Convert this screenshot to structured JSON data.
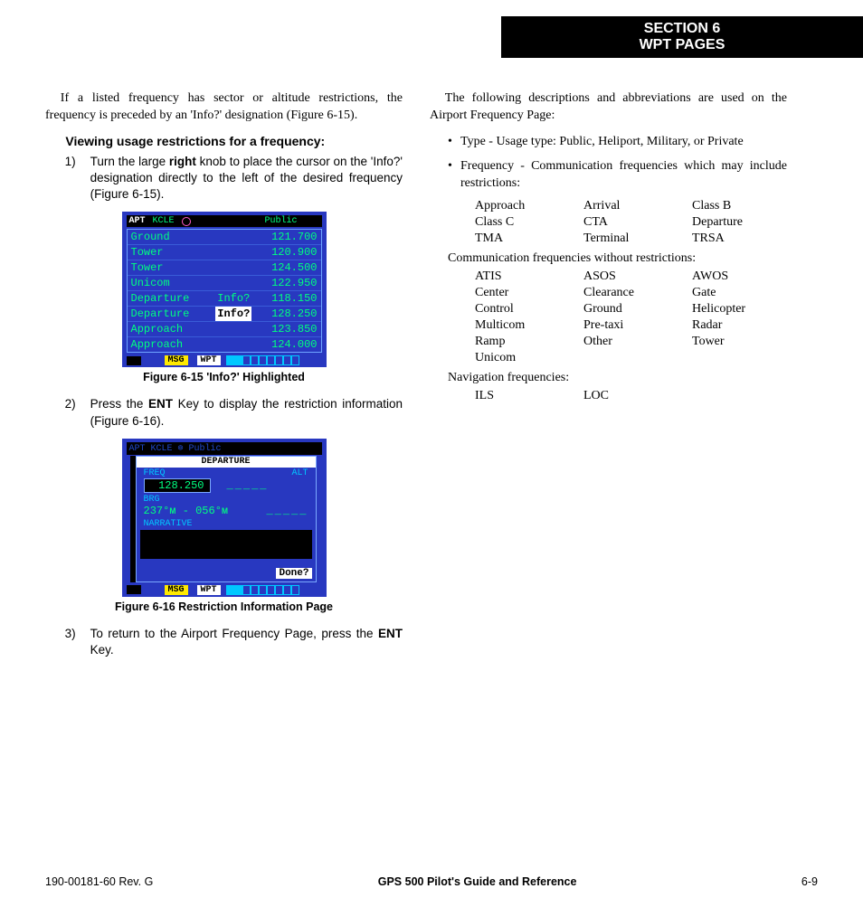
{
  "header": {
    "line1": "SECTION 6",
    "line2": "WPT PAGES"
  },
  "leftCol": {
    "intro": "If a listed frequency has sector or altitude restrictions, the frequency is preceded by an 'Info?' designation (Figure 6-15).",
    "subheading": "Viewing usage restrictions for a frequency:",
    "step1_num": "1)",
    "step1_pre": "Turn the large ",
    "step1_bold": "right",
    "step1_post": " knob to place the cursor on the 'Info?' designation directly to the left of the desired frequency (Figure 6-15).",
    "step2_num": "2)",
    "step2_pre": "Press the ",
    "step2_bold": "ENT",
    "step2_post": " Key to display the restriction information (Figure 6-16).",
    "step3_num": "3)",
    "step3_pre": "To return to the Airport Frequency Page, press the ",
    "step3_bold": "ENT",
    "step3_post": " Key.",
    "fig1cap": "Figure 6-15  'Info?' Highlighted",
    "fig2cap": "Figure 6-16  Restriction Information Page"
  },
  "device1": {
    "apt": "APT",
    "id": "KCLE",
    "pub": "Public",
    "rows": [
      {
        "name": "Ground",
        "mid": "",
        "freq": "121.700"
      },
      {
        "name": "Tower",
        "mid": "",
        "freq": "120.900"
      },
      {
        "name": "Tower",
        "mid": "",
        "freq": "124.500"
      },
      {
        "name": "Unicom",
        "mid": "",
        "freq": "122.950"
      },
      {
        "name": "Departure",
        "mid": "Info?",
        "hl": false,
        "freq": "118.150"
      },
      {
        "name": "Departure",
        "mid": "Info?",
        "hl": true,
        "freq": "128.250"
      },
      {
        "name": "Approach",
        "mid": "",
        "freq": "123.850"
      },
      {
        "name": "Approach",
        "mid": "",
        "freq": "124.000"
      }
    ],
    "msg": "MSG",
    "wpt": "WPT"
  },
  "device2": {
    "ghost": "APT KCLE    ⊚   Public",
    "title": "DEPARTURE",
    "lblFreq": "FREQ",
    "lblAlt": "ALT",
    "freq": "128.250",
    "dash": "_____",
    "lblBrg": "BRG",
    "brg": "237°ᴍ - 056°ᴍ",
    "dash2": "_____",
    "lblNarr": "NARRATIVE",
    "done": "Done?",
    "msg": "MSG",
    "wpt": "WPT"
  },
  "rightCol": {
    "intro": "The following descriptions and abbreviations are used on the Airport Frequency Page:",
    "bullet1": "Type - Usage type: Public, Heliport, Military, or Private",
    "bullet2": "Frequency - Communication frequencies which may include restrictions:",
    "restr": [
      "Approach",
      "Arrival",
      "Class B",
      "Class C",
      "CTA",
      "Departure",
      "TMA",
      "Terminal",
      "TRSA"
    ],
    "sub2": "Communication frequencies without restrictions:",
    "norestr": [
      "ATIS",
      "ASOS",
      "AWOS",
      "Center",
      "Clearance",
      "Gate",
      "Control",
      "Ground",
      "Helicopter",
      "Multicom",
      "Pre-taxi",
      "Radar",
      "Ramp",
      "Other",
      "Tower",
      "Unicom",
      "",
      ""
    ],
    "sub3": "Navigation frequencies:",
    "nav": [
      "ILS",
      "LOC",
      ""
    ]
  },
  "footer": {
    "left": "190-00181-60  Rev. G",
    "center": "GPS 500 Pilot's Guide and Reference",
    "right": "6-9"
  }
}
